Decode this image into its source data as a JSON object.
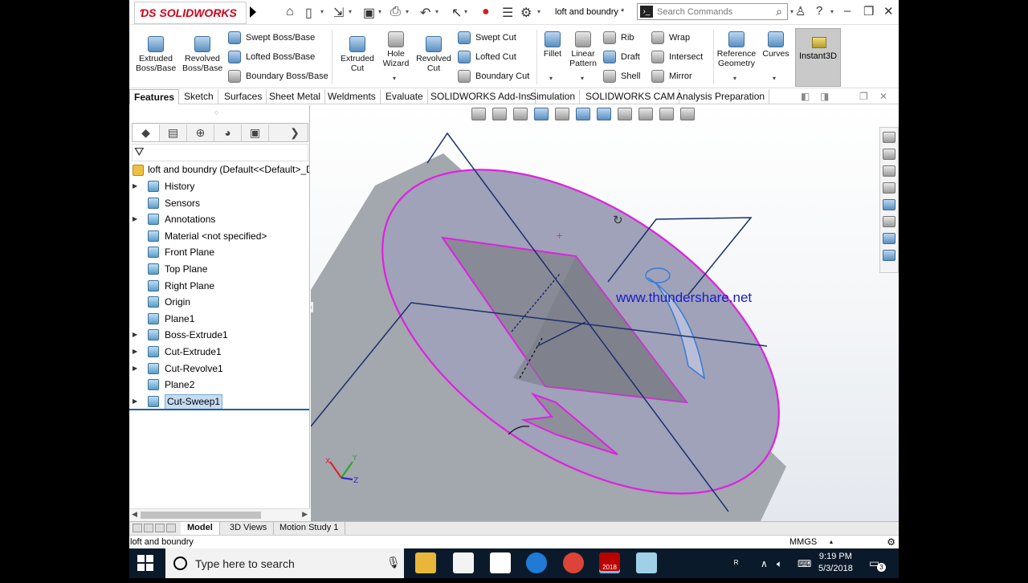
{
  "app": {
    "brand": "SOLIDWORKS",
    "doc_title": "loft and boundry *",
    "search_placeholder": "Search Commands"
  },
  "ribbon": {
    "extruded_boss": "Extruded Boss/Base",
    "revolved_boss": "Revolved Boss/Base",
    "swept_boss": "Swept Boss/Base",
    "lofted_boss": "Lofted Boss/Base",
    "boundary_boss": "Boundary Boss/Base",
    "extruded_cut": "Extruded Cut",
    "hole_wizard": "Hole Wizard",
    "revolved_cut": "Revolved Cut",
    "swept_cut": "Swept Cut",
    "lofted_cut": "Lofted Cut",
    "boundary_cut": "Boundary Cut",
    "fillet": "Fillet",
    "linear_pattern": "Linear Pattern",
    "rib": "Rib",
    "draft": "Draft",
    "shell": "Shell",
    "wrap": "Wrap",
    "intersect": "Intersect",
    "mirror": "Mirror",
    "reference_geometry": "Reference Geometry",
    "curves": "Curves",
    "instant3d": "Instant3D"
  },
  "tabs": [
    "Features",
    "Sketch",
    "Surfaces",
    "Sheet Metal",
    "Weldments",
    "Evaluate",
    "SOLIDWORKS Add-Ins",
    "Simulation",
    "SOLIDWORKS CAM",
    "Analysis Preparation"
  ],
  "tree": {
    "root": "loft and boundry  (Default<<Default>_Di",
    "items": [
      {
        "label": "History",
        "expandable": true
      },
      {
        "label": "Sensors",
        "expandable": false
      },
      {
        "label": "Annotations",
        "expandable": true
      },
      {
        "label": "Material <not specified>",
        "expandable": false
      },
      {
        "label": "Front Plane",
        "expandable": false
      },
      {
        "label": "Top Plane",
        "expandable": false
      },
      {
        "label": "Right Plane",
        "expandable": false
      },
      {
        "label": "Origin",
        "expandable": false
      },
      {
        "label": "Plane1",
        "expandable": false
      },
      {
        "label": "Boss-Extrude1",
        "expandable": true
      },
      {
        "label": "Cut-Extrude1",
        "expandable": true
      },
      {
        "label": "Cut-Revolve1",
        "expandable": true
      },
      {
        "label": "Plane2",
        "expandable": false
      },
      {
        "label": "Cut-Sweep1",
        "expandable": true,
        "selected": true
      }
    ]
  },
  "viewport": {
    "watermark": "www.thundershare.net",
    "triad": {
      "x": "X",
      "y": "Y",
      "z": "Z"
    }
  },
  "bottom_tabs": [
    "Model",
    "3D Views",
    "Motion Study 1"
  ],
  "status": {
    "left": "loft and boundry",
    "units": "MMGS"
  },
  "taskbar": {
    "search_placeholder": "Type here to search",
    "sw_badge": "2018",
    "time": "9:19 PM",
    "date": "5/3/2018",
    "notif_count": "3"
  },
  "colors": {
    "selection": "#e020e0",
    "sketch_line": "#1a2f6a",
    "accent": "#1e5fa8"
  }
}
